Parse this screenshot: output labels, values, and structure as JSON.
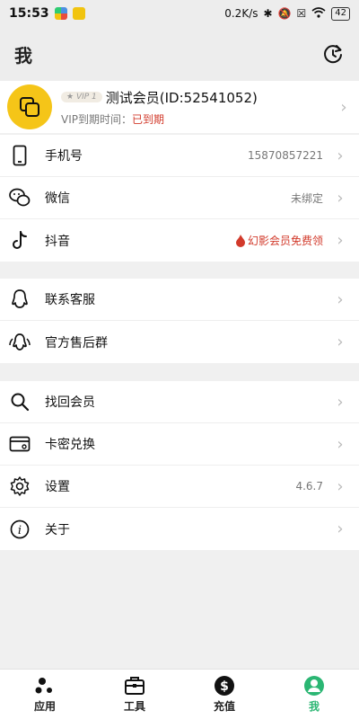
{
  "status_bar": {
    "time": "15:53",
    "net_speed": "0.2K/s",
    "battery": "42"
  },
  "header": {
    "title": "我"
  },
  "profile": {
    "vip_badge": "VIP 1",
    "name": "测试会员(ID:52541052)",
    "expiry_label": "VIP到期时间：",
    "expiry_value": "已到期"
  },
  "section1": {
    "items": [
      {
        "label": "手机号",
        "value": "15870857221",
        "icon": "phone-icon"
      },
      {
        "label": "微信",
        "value": "未绑定",
        "icon": "wechat-icon"
      },
      {
        "label": "抖音",
        "value": "幻影会员免费领",
        "icon": "tiktok-icon"
      }
    ]
  },
  "section2": {
    "items": [
      {
        "label": "联系客服",
        "icon": "qq-icon"
      },
      {
        "label": "官方售后群",
        "icon": "qq-group-icon"
      }
    ]
  },
  "section3": {
    "items": [
      {
        "label": "找回会员",
        "icon": "search-icon"
      },
      {
        "label": "卡密兑换",
        "icon": "card-icon"
      },
      {
        "label": "设置",
        "value": "4.6.7",
        "icon": "gear-icon"
      },
      {
        "label": "关于",
        "icon": "info-icon"
      }
    ]
  },
  "bottom_nav": {
    "items": [
      {
        "label": "应用",
        "icon": "apps-icon",
        "active": false
      },
      {
        "label": "工具",
        "icon": "toolbox-icon",
        "active": false
      },
      {
        "label": "充值",
        "icon": "dollar-icon",
        "active": false
      },
      {
        "label": "我",
        "icon": "user-icon",
        "active": true
      }
    ]
  },
  "colors": {
    "accent": "#2bb673",
    "danger": "#d23a2b",
    "avatar_bg": "#f5c518"
  }
}
